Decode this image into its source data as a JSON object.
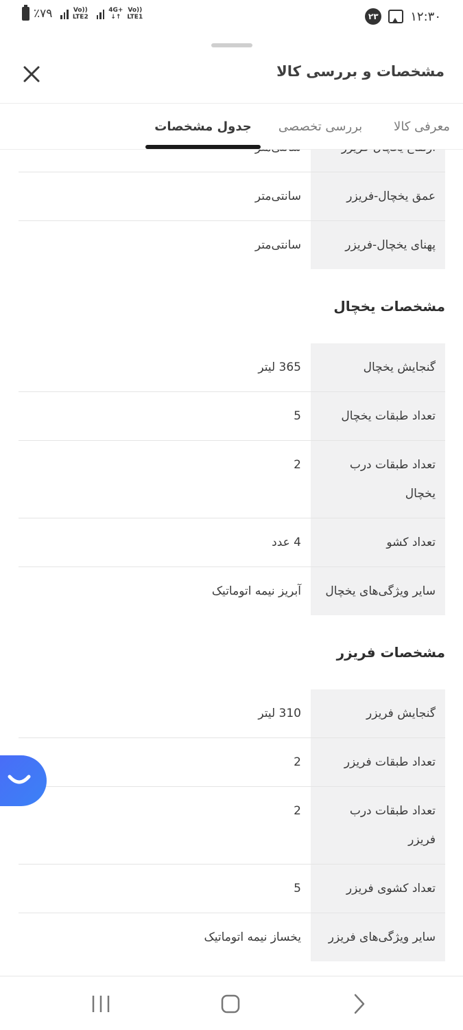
{
  "status_bar": {
    "battery_pct": "٪۷۹",
    "net1_top": "Vo))",
    "net1_bottom": "LTE2",
    "net2_top": "4G+",
    "net2_mid": "↓↑",
    "net3_top": "Vo))",
    "net3_bottom": "LTE1",
    "notification_badge": "۲۳",
    "time": "۱۲:۳۰"
  },
  "header": {
    "title": "مشخصات و بررسی کالا",
    "close_icon": "close-icon"
  },
  "tabs": [
    {
      "label": "معرفی کالا",
      "active": false
    },
    {
      "label": "بررسی تخصصی",
      "active": false
    },
    {
      "label": "جدول مشخصات",
      "active": true
    }
  ],
  "dimensions_rows": [
    {
      "key": "ارتفاع یخچال-فریزر",
      "value": "سانتی‌متر"
    },
    {
      "key": "عمق یخچال-فریزر",
      "value": "سانتی‌متر"
    },
    {
      "key": "پهنای یخچال-فریزر",
      "value": "سانتی‌متر"
    }
  ],
  "fridge_section": {
    "title": "مشخصات یخچال",
    "rows": [
      {
        "key": "گنجایش یخچال",
        "value": "365 لیتر"
      },
      {
        "key": "تعداد طبقات یخچال",
        "value": "5"
      },
      {
        "key": "تعداد طبقات درب یخچال",
        "value": "2"
      },
      {
        "key": "تعداد کشو",
        "value": "4 عدد"
      },
      {
        "key": "سایر ویژگی‌های یخچال",
        "value": "آبریز نیمه اتوماتیک"
      }
    ]
  },
  "freezer_section": {
    "title": "مشخصات فریزر",
    "rows": [
      {
        "key": "گنجایش فریزر",
        "value": "310 لیتر"
      },
      {
        "key": "تعداد طبقات فریزر",
        "value": "2"
      },
      {
        "key": "تعداد طبقات درب فریزر",
        "value": "2"
      },
      {
        "key": "تعداد کشوی فریزر",
        "value": "5"
      },
      {
        "key": "سایر ویژگی‌های فریزر",
        "value": "یخساز نیمه اتوماتیک"
      }
    ]
  },
  "chat_button_icon": "smile-chat-icon",
  "nav": {
    "recent_icon": "recent-apps-icon",
    "home_icon": "home-icon",
    "back_icon": "back-chevron-icon"
  },
  "colors": {
    "key_cell_bg": "#f1f1f2",
    "tab_underline": "#1a1a1a",
    "fab_gradient_start": "#4a6cf7",
    "fab_gradient_end": "#3b82f6"
  }
}
